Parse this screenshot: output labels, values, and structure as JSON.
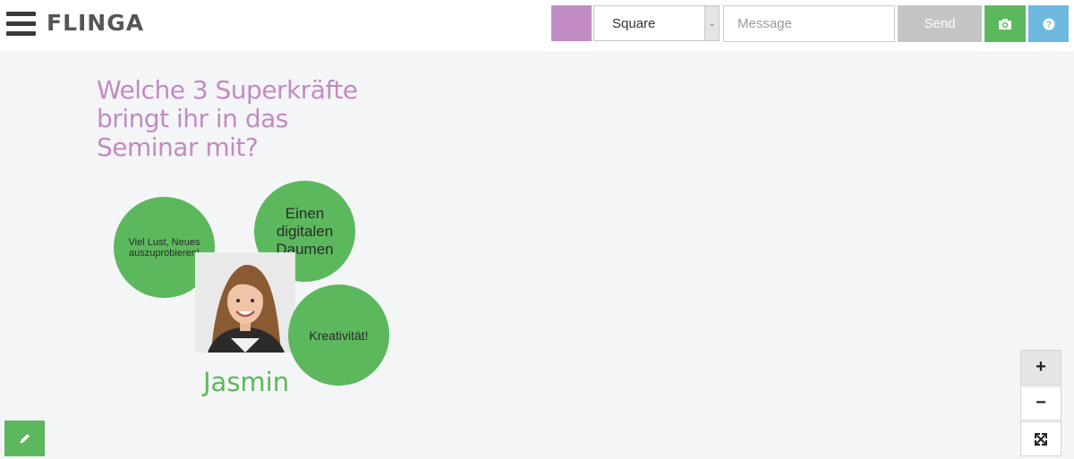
{
  "app": {
    "logo_text": "FLINGA"
  },
  "toolbar": {
    "color_swatch": "#c18bc3",
    "shape_select_value": "Square",
    "message_placeholder": "Message",
    "send_label": "Send",
    "camera_icon": "camera-icon",
    "help_icon": "question-icon"
  },
  "board": {
    "title": "Welche 3 Superkräfte bringt ihr in das Seminar mit?",
    "bubbles": [
      {
        "text": "Viel Lust, Neues auszuprobieren!"
      },
      {
        "text": "Einen digitalen Daumen"
      },
      {
        "text": "Kreativität!"
      }
    ],
    "person_name": "Jasmin"
  },
  "zoom_controls": {
    "zoom_in": "+",
    "zoom_out": "−"
  },
  "colors": {
    "accent_purple": "#c18bc3",
    "accent_green": "#5cb85c",
    "help_blue": "#6eb8df",
    "send_gray": "#c4c4c4",
    "canvas_bg": "#f4f5f7"
  }
}
